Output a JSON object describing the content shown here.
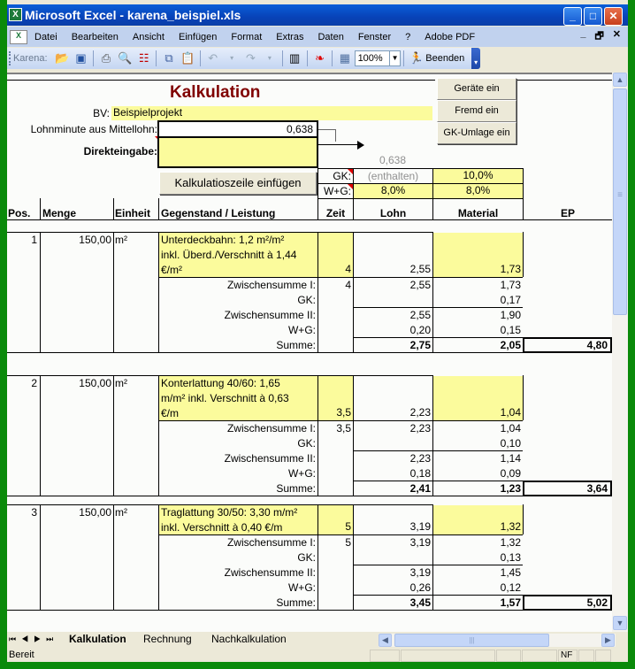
{
  "window": {
    "title": "Microsoft Excel - karena_beispiel.xls",
    "controls": {
      "minimize": "_",
      "maximize": "□",
      "close": "✕"
    }
  },
  "menubar": {
    "items": [
      "Datei",
      "Bearbeiten",
      "Ansicht",
      "Einfügen",
      "Format",
      "Extras",
      "Daten",
      "Fenster",
      "?",
      "Adobe PDF"
    ],
    "doc_controls": {
      "minimize": "_",
      "restore": "🗗",
      "close": "✕"
    }
  },
  "toolbar": {
    "label": "Karena:",
    "zoom": "100%",
    "beenden_label": "Beenden",
    "icons": [
      "open-folder-icon",
      "save-icon",
      "print-icon",
      "print-preview-icon",
      "form-icon",
      "copy-icon",
      "paste-icon",
      "undo-icon",
      "redo-icon",
      "columns-icon",
      "footprints-icon",
      "calculator-icon"
    ]
  },
  "sheet": {
    "title": "Kalkulation",
    "bv_label": "BV:",
    "bv_value": "Beispielprojekt",
    "lohnminute_label": "Lohnminute aus Mittellohn:",
    "lohnminute_value": "0,638",
    "direkteingabe_label": "Direkteingabe:",
    "direkteingabe_value": "",
    "lohn_ref_value": "0,638",
    "buttons": {
      "kalkulationszeile": "Kalkulatioszeile einfügen",
      "geraete": "Geräte ein",
      "fremd": "Fremd ein",
      "gk_umlage": "GK-Umlage ein"
    },
    "rates": {
      "gk_label": "GK:",
      "gk_lohn": "(enthalten)",
      "gk_material": "10,0%",
      "wg_label": "W+G:",
      "wg_lohn": "8,0%",
      "wg_material": "8,0%"
    },
    "headers": {
      "pos": "Pos.",
      "menge": "Menge",
      "einheit": "Einheit",
      "gegenstand": "Gegenstand / Leistung",
      "zeit": "Zeit",
      "lohn": "Lohn",
      "material": "Material",
      "ep": "EP"
    },
    "sub_labels": {
      "zs1": "Zwischensumme I:",
      "gk": "GK:",
      "zs2": "Zwischensumme II:",
      "wg": "W+G:",
      "summe": "Summe:"
    },
    "positions": [
      {
        "pos": "1",
        "menge": "150,00",
        "einheit": "m²",
        "text": [
          "Unterdeckbahn: 1,2 m²/m²",
          "inkl. Überd./Verschnitt à 1,44",
          "€/m²"
        ],
        "zeit": "4",
        "lohn": "2,55",
        "material": "1,73",
        "zs1": {
          "zeit": "4",
          "lohn": "2,55",
          "material": "1,73"
        },
        "gk": {
          "lohn": "",
          "material": "0,17"
        },
        "zs2": {
          "lohn": "2,55",
          "material": "1,90"
        },
        "wg": {
          "lohn": "0,20",
          "material": "0,15"
        },
        "summe": {
          "lohn": "2,75",
          "material": "2,05",
          "ep": "4,80"
        }
      },
      {
        "pos": "2",
        "menge": "150,00",
        "einheit": "m²",
        "text": [
          "Konterlattung 40/60: 1,65",
          "m/m² inkl. Verschnitt à 0,63",
          "€/m"
        ],
        "zeit": "3,5",
        "lohn": "2,23",
        "material": "1,04",
        "zs1": {
          "zeit": "3,5",
          "lohn": "2,23",
          "material": "1,04"
        },
        "gk": {
          "lohn": "",
          "material": "0,10"
        },
        "zs2": {
          "lohn": "2,23",
          "material": "1,14"
        },
        "wg": {
          "lohn": "0,18",
          "material": "0,09"
        },
        "summe": {
          "lohn": "2,41",
          "material": "1,23",
          "ep": "3,64"
        }
      },
      {
        "pos": "3",
        "menge": "150,00",
        "einheit": "m²",
        "text": [
          "Traglattung 30/50: 3,30 m/m²",
          "inkl. Verschnitt à 0,40 €/m"
        ],
        "zeit": "5",
        "lohn": "3,19",
        "material": "1,32",
        "zs1": {
          "zeit": "5",
          "lohn": "3,19",
          "material": "1,32"
        },
        "gk": {
          "lohn": "",
          "material": "0,13"
        },
        "zs2": {
          "lohn": "3,19",
          "material": "1,45"
        },
        "wg": {
          "lohn": "0,26",
          "material": "0,12"
        },
        "summe": {
          "lohn": "3,45",
          "material": "1,57",
          "ep": "5,02"
        }
      }
    ]
  },
  "tabs": {
    "items": [
      "Kalkulation",
      "Rechnung",
      "Nachkalkulation"
    ],
    "active": "Kalkulation"
  },
  "statusbar": {
    "status": "Bereit",
    "indicator": "NF"
  },
  "colors": {
    "title_red": "#800000",
    "input_yellow": "#fbfb9c",
    "desktop_green": "#0a8a0a"
  }
}
